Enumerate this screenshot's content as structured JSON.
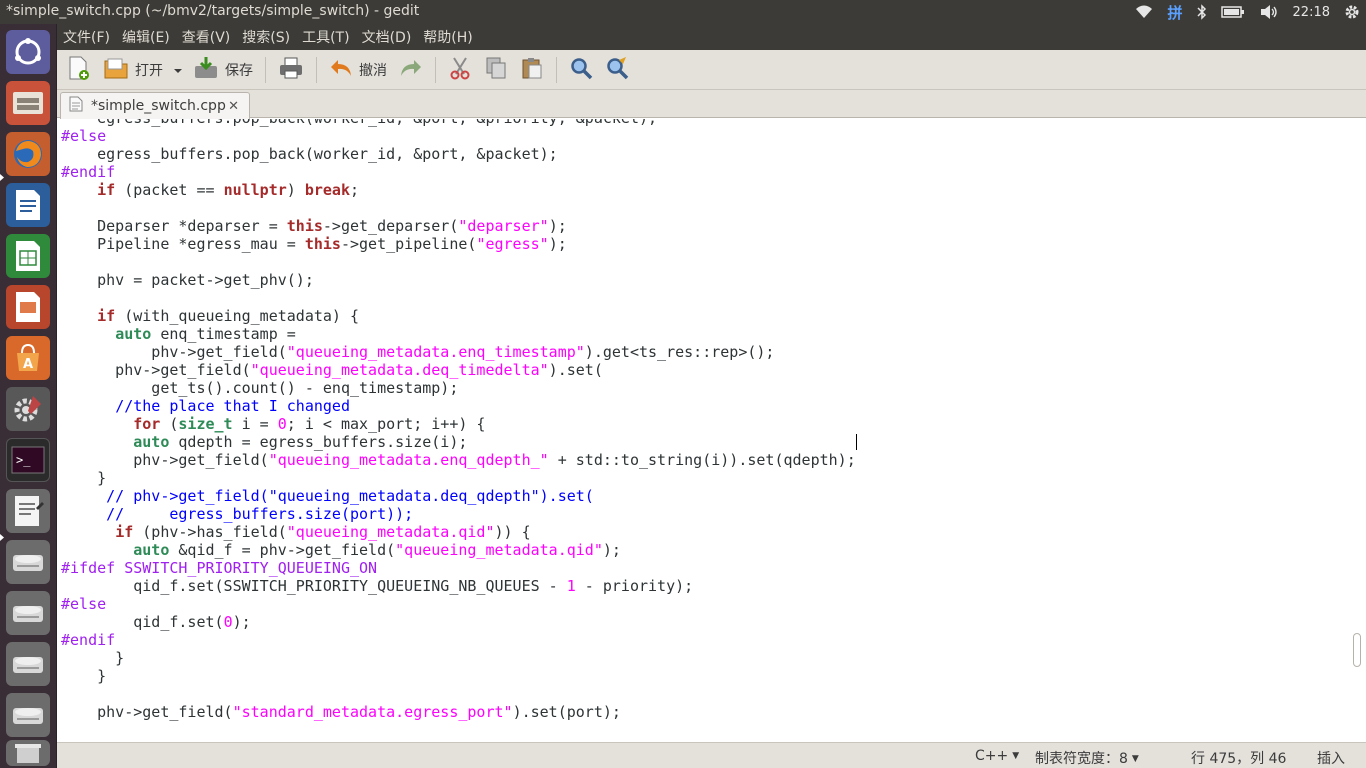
{
  "window": {
    "title": "*simple_switch.cpp (~/bmv2/targets/simple_switch) - gedit"
  },
  "tray": {
    "ime": "拼",
    "clock": "22:18"
  },
  "launcher": {
    "items": [
      "dash",
      "files",
      "firefox",
      "writer",
      "calc",
      "impress",
      "software-center",
      "system-settings",
      "terminal",
      "text-editor",
      "drive-1",
      "drive-2",
      "drive-3",
      "drive-4",
      "trash"
    ]
  },
  "menubar": {
    "items": [
      "文件(F)",
      "编辑(E)",
      "查看(V)",
      "搜索(S)",
      "工具(T)",
      "文档(D)",
      "帮助(H)"
    ]
  },
  "toolbar": {
    "open_label": "打开",
    "save_label": "保存",
    "undo_label": "撤消"
  },
  "tab": {
    "label": "*simple_switch.cpp",
    "close": "✕"
  },
  "editor": {
    "lines": [
      [
        [
          "    egress_buffers.pop_back(worker_id, &port, &priority, &packet);",
          ""
        ]
      ],
      [
        [
          "#else",
          "pp"
        ]
      ],
      [
        [
          "    egress_buffers.pop_back(worker_id, &port, &packet);",
          ""
        ]
      ],
      [
        [
          "#endif",
          "pp"
        ]
      ],
      [
        [
          "    ",
          ""
        ],
        [
          "if",
          "kw"
        ],
        [
          " (packet == ",
          ""
        ],
        [
          "nullptr",
          "kw"
        ],
        [
          ") ",
          ""
        ],
        [
          "break",
          "kw"
        ],
        [
          ";",
          ""
        ]
      ],
      [
        [
          "",
          ""
        ]
      ],
      [
        [
          "    Deparser *deparser = ",
          ""
        ],
        [
          "this",
          "kw"
        ],
        [
          "->get_deparser(",
          ""
        ],
        [
          "\"deparser\"",
          "st"
        ],
        [
          ");",
          ""
        ]
      ],
      [
        [
          "    Pipeline *egress_mau = ",
          ""
        ],
        [
          "this",
          "kw"
        ],
        [
          "->get_pipeline(",
          ""
        ],
        [
          "\"egress\"",
          "st"
        ],
        [
          ");",
          ""
        ]
      ],
      [
        [
          "",
          ""
        ]
      ],
      [
        [
          "    phv = packet->get_phv();",
          ""
        ]
      ],
      [
        [
          "",
          ""
        ]
      ],
      [
        [
          "    ",
          ""
        ],
        [
          "if",
          "kw"
        ],
        [
          " (with_queueing_metadata) {",
          ""
        ]
      ],
      [
        [
          "      ",
          ""
        ],
        [
          "auto",
          "ty"
        ],
        [
          " enq_timestamp =",
          ""
        ]
      ],
      [
        [
          "          phv->get_field(",
          ""
        ],
        [
          "\"queueing_metadata.enq_timestamp\"",
          "st"
        ],
        [
          ").get<ts_res::rep>();",
          ""
        ]
      ],
      [
        [
          "      phv->get_field(",
          ""
        ],
        [
          "\"queueing_metadata.deq_timedelta\"",
          "st"
        ],
        [
          ").set(",
          ""
        ]
      ],
      [
        [
          "          get_ts().count() - enq_timestamp);",
          ""
        ]
      ],
      [
        [
          "      ",
          ""
        ],
        [
          "//the place that I changed",
          "cm"
        ]
      ],
      [
        [
          "        ",
          ""
        ],
        [
          "for",
          "kw"
        ],
        [
          " (",
          ""
        ],
        [
          "size_t",
          "ty"
        ],
        [
          " i = ",
          ""
        ],
        [
          "0",
          "nm"
        ],
        [
          "; i < max_port; i++) {",
          ""
        ]
      ],
      [
        [
          "        ",
          ""
        ],
        [
          "auto",
          "ty"
        ],
        [
          " qdepth = egress_buffers.size(i);",
          ""
        ]
      ],
      [
        [
          "        phv->get_field(",
          ""
        ],
        [
          "\"queueing_metadata.enq_qdepth_\"",
          "st"
        ],
        [
          " + std::to_string(i)).set(qdepth);",
          ""
        ]
      ],
      [
        [
          "    }",
          ""
        ]
      ],
      [
        [
          "     ",
          ""
        ],
        [
          "// phv->get_field(\"queueing_metadata.deq_qdepth\").set(",
          "cm"
        ]
      ],
      [
        [
          "     ",
          ""
        ],
        [
          "//     egress_buffers.size(port));",
          "cm"
        ]
      ],
      [
        [
          "      ",
          ""
        ],
        [
          "if",
          "kw"
        ],
        [
          " (phv->has_field(",
          ""
        ],
        [
          "\"queueing_metadata.qid\"",
          "st"
        ],
        [
          ")) {",
          ""
        ]
      ],
      [
        [
          "        ",
          ""
        ],
        [
          "auto",
          "ty"
        ],
        [
          " &qid_f = phv->get_field(",
          ""
        ],
        [
          "\"queueing_metadata.qid\"",
          "st"
        ],
        [
          ");",
          ""
        ]
      ],
      [
        [
          "#ifdef SSWITCH_PRIORITY_QUEUEING_ON",
          "pp"
        ]
      ],
      [
        [
          "        qid_f.set(SSWITCH_PRIORITY_QUEUEING_NB_QUEUES - ",
          ""
        ],
        [
          "1",
          "nm"
        ],
        [
          " - priority);",
          ""
        ]
      ],
      [
        [
          "#else",
          "pp"
        ]
      ],
      [
        [
          "        qid_f.set(",
          ""
        ],
        [
          "0",
          "nm"
        ],
        [
          ");",
          ""
        ]
      ],
      [
        [
          "#endif",
          "pp"
        ]
      ],
      [
        [
          "      }",
          ""
        ]
      ],
      [
        [
          "    }",
          ""
        ]
      ],
      [
        [
          "",
          ""
        ]
      ],
      [
        [
          "    phv->get_field(",
          ""
        ],
        [
          "\"standard_metadata.egress_port\"",
          "st"
        ],
        [
          ").set(port);",
          ""
        ]
      ]
    ]
  },
  "statusbar": {
    "language": "C++",
    "tab_width": "制表符宽度：8",
    "position": "行 475，列 46",
    "mode": "插入"
  },
  "colors": {
    "panel": "#3c3b37",
    "launcher": "#3a2e36",
    "toolbar": "#e4e1db",
    "keyword": "#a52a2a",
    "type": "#2e8b57",
    "preprocessor": "#a020f0",
    "string": "#ff00ff",
    "comment": "#0000ff"
  }
}
